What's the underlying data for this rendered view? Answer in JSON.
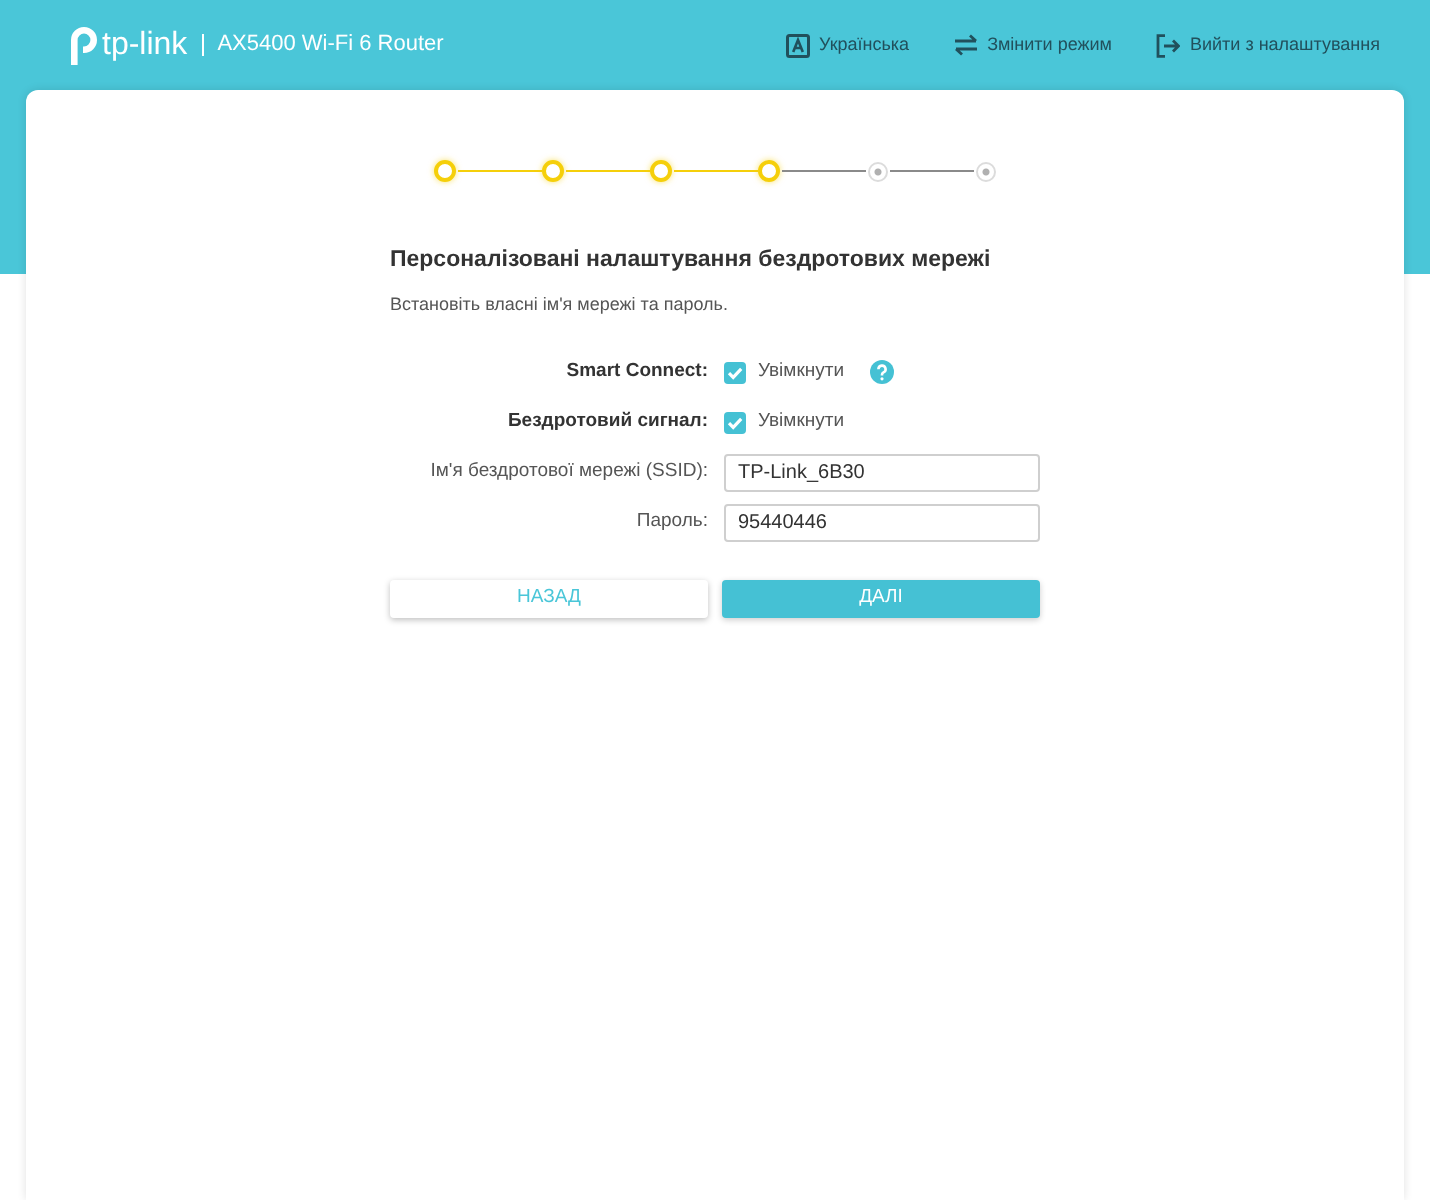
{
  "header": {
    "brand": "tp-link",
    "product": "AX5400 Wi-Fi 6 Router",
    "nav": [
      {
        "kind": "language",
        "label": "Українська"
      },
      {
        "kind": "mode",
        "label": "Змінити режим"
      },
      {
        "kind": "exit",
        "label": "Вийти з налаштування"
      }
    ]
  },
  "stepper": {
    "steps": [
      {
        "completed": true
      },
      {
        "completed": true
      },
      {
        "completed": true
      },
      {
        "completed": true
      },
      {
        "completed": false
      },
      {
        "completed": false
      }
    ]
  },
  "form": {
    "title": "Персоналізовані налаштування бездротових мережі",
    "subtitle": "Встановіть власні ім'я мережі та пароль.",
    "rows": [
      {
        "kind": "checkbox",
        "label": "Smart Connect:",
        "option": "Увімкнути",
        "checked": true,
        "help": true
      },
      {
        "kind": "checkbox",
        "label": "Бездротовий сигнал:",
        "option": "Увімкнути",
        "checked": true
      },
      {
        "kind": "text",
        "label": "Ім'я бездротової мережі (SSID):",
        "value": "TP-Link_6B30"
      },
      {
        "kind": "text",
        "label": "Пароль:",
        "value": "95440446"
      }
    ]
  },
  "buttons": [
    {
      "kind": "secondary",
      "label": "НАЗАД"
    },
    {
      "kind": "primary",
      "label": "ДАЛІ"
    }
  ]
}
